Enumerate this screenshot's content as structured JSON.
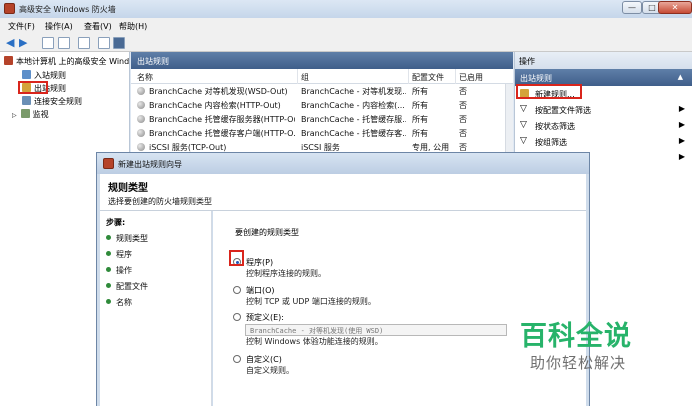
{
  "window": {
    "title": "高级安全 Windows 防火墙",
    "minimize": "—",
    "maximize": "□",
    "close": "✕"
  },
  "menu": [
    "文件(F)",
    "操作(A)",
    "查看(V)",
    "帮助(H)"
  ],
  "tree": {
    "root": "本地计算机 上的高级安全 Wind",
    "items": [
      "入站规则",
      "出站规则",
      "连接安全规则",
      "监视"
    ]
  },
  "middle": {
    "header": "出站规则",
    "columns": [
      "名称",
      "组",
      "配置文件",
      "已启用"
    ],
    "rows": [
      {
        "name": "BranchCache 对等机发现(WSD-Out)",
        "group": "BranchCache - 对等机发现...",
        "profile": "所有",
        "enabled": "否"
      },
      {
        "name": "BranchCache 内容检索(HTTP-Out)",
        "group": "BranchCache - 内容检索(...",
        "profile": "所有",
        "enabled": "否"
      },
      {
        "name": "BranchCache 托管缓存服务器(HTTP-Out)",
        "group": "BranchCache - 托管缓存服...",
        "profile": "所有",
        "enabled": "否"
      },
      {
        "name": "BranchCache 托管缓存客户端(HTTP-O...",
        "group": "BranchCache - 托管缓存客...",
        "profile": "所有",
        "enabled": "否"
      },
      {
        "name": "iSCSI 服务(TCP-Out)",
        "group": "iSCSI 服务",
        "profile": "专用, 公用",
        "enabled": "否"
      }
    ]
  },
  "actions": {
    "title": "操作",
    "group": "出站规则",
    "items": [
      {
        "label": "新建规则...",
        "arrow": ""
      },
      {
        "label": "按配置文件筛选",
        "arrow": "▶"
      },
      {
        "label": "按状态筛选",
        "arrow": "▶"
      },
      {
        "label": "按组筛选",
        "arrow": "▶"
      }
    ],
    "extra_arrow": "▶"
  },
  "dialog": {
    "title": "新建出站规则向导",
    "heading": "规则类型",
    "subheading": "选择要创建的防火墙规则类型",
    "steps_header": "步骤:",
    "steps": [
      "规则类型",
      "程序",
      "操作",
      "配置文件",
      "名称"
    ],
    "question": "要创建的规则类型",
    "options": [
      {
        "title": "程序(P)",
        "desc": "控制程序连接的规则。",
        "selected": true
      },
      {
        "title": "端口(O)",
        "desc": "控制 TCP 或 UDP 端口连接的规则。",
        "selected": false
      },
      {
        "title": "预定义(E):",
        "desc": "控制 Windows 体验功能连接的规则。",
        "selected": false
      },
      {
        "title": "自定义(C)",
        "desc": "自定义规则。",
        "selected": false
      }
    ],
    "predefined_value": "BranchCache - 对等机发现(使用 WSD)"
  },
  "watermark": {
    "main": "百科全说",
    "sub": "助你轻松解决"
  },
  "colors": {
    "header_blue": "#3f5e8a",
    "highlight_red": "#d9251c",
    "watermark_green": "#27b36a"
  }
}
